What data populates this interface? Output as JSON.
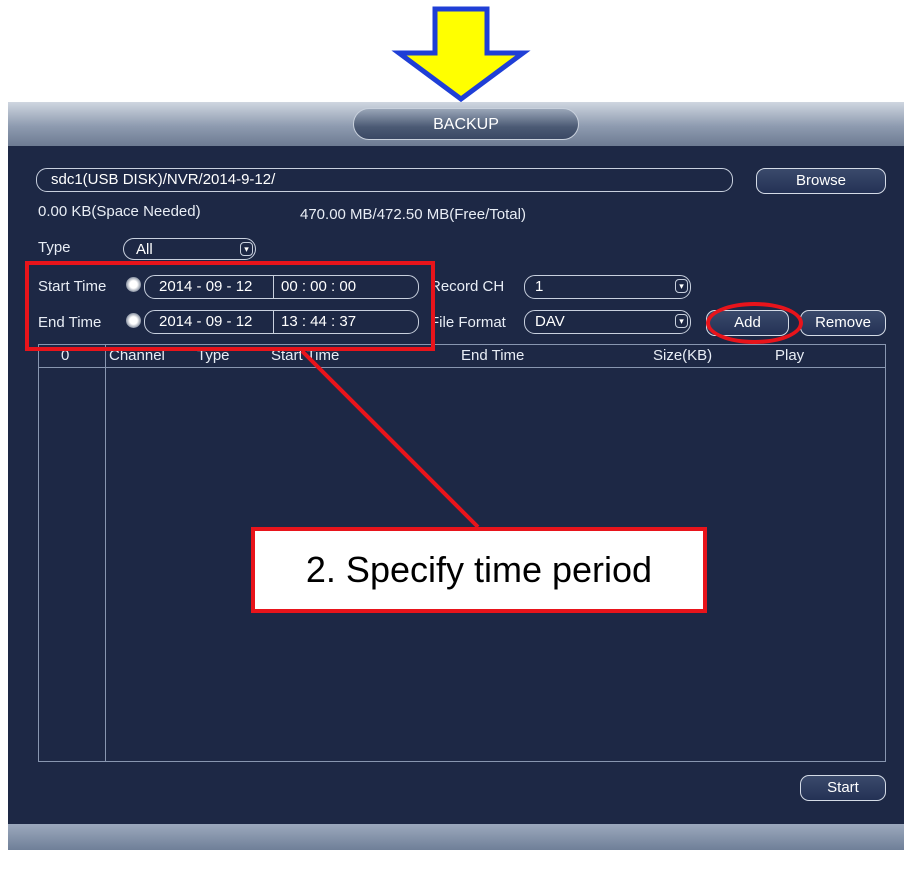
{
  "window": {
    "title": "BACKUP"
  },
  "path": {
    "value": "sdc1(USB DISK)/NVR/2014-9-12/"
  },
  "buttons": {
    "browse": "Browse",
    "add": "Add",
    "remove": "Remove",
    "start": "Start"
  },
  "space": {
    "needed": "0.00 KB(Space Needed)",
    "free_total": "470.00 MB/472.50 MB(Free/Total)"
  },
  "type": {
    "label": "Type",
    "value": "All"
  },
  "start_time": {
    "label": "Start Time",
    "date": "2014 - 09 - 12",
    "time": "00 : 00 : 00"
  },
  "end_time": {
    "label": "End Time",
    "date": "2014 - 09 - 12",
    "time": "13 : 44 : 37"
  },
  "record_ch": {
    "label": "Record CH",
    "value": "1"
  },
  "file_format": {
    "label": "File Format",
    "value": "DAV"
  },
  "table": {
    "columns": [
      "0",
      "Channel",
      "Type",
      "Start Time",
      "End Time",
      "Size(KB)",
      "Play"
    ]
  },
  "annotation": {
    "callout_text": "2. Specify time period"
  },
  "colors": {
    "panel": "#1d2845",
    "annotation_red": "#e8141b",
    "arrow_fill": "#ffff00",
    "arrow_stroke": "#1f3fd6"
  }
}
